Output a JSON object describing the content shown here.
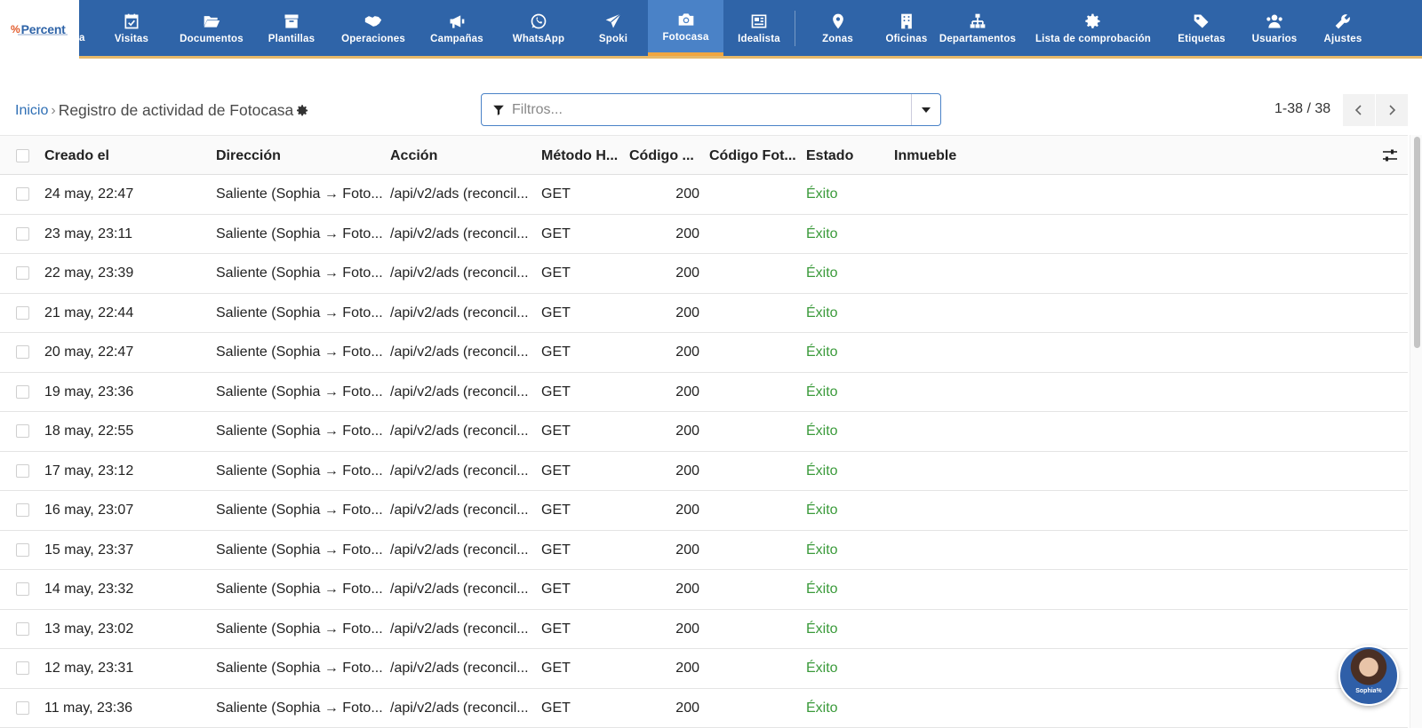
{
  "brand": {
    "logo_mark": "%",
    "logo_word": "Percent"
  },
  "nav": {
    "cut_label": "a",
    "items": [
      {
        "label": "Visitas",
        "icon": "calendar-check-icon"
      },
      {
        "label": "Documentos",
        "icon": "folder-open-icon"
      },
      {
        "label": "Plantillas",
        "icon": "archive-box-icon"
      },
      {
        "label": "Operaciones",
        "icon": "handshake-icon"
      },
      {
        "label": "Campañas",
        "icon": "megaphone-icon"
      },
      {
        "label": "WhatsApp",
        "icon": "whatsapp-icon"
      },
      {
        "label": "Spoki",
        "icon": "paper-plane-icon"
      },
      {
        "label": "Fotocasa",
        "icon": "camera-icon",
        "active": true
      },
      {
        "label": "Idealista",
        "icon": "newspaper-icon"
      },
      {
        "label": "Zonas",
        "icon": "map-pin-icon"
      },
      {
        "label": "Oficinas",
        "icon": "building-icon"
      },
      {
        "label": "Departamentos",
        "icon": "org-chart-icon"
      },
      {
        "label": "Lista de comprobación",
        "icon": "gear-icon"
      },
      {
        "label": "Etiquetas",
        "icon": "tags-icon"
      },
      {
        "label": "Usuarios",
        "icon": "users-icon"
      },
      {
        "label": "Ajustes",
        "icon": "wrench-icon"
      }
    ]
  },
  "breadcrumb": {
    "home": "Inicio",
    "separator": "›",
    "current": "Registro de actividad de Fotocasa"
  },
  "filter": {
    "placeholder": "Filtros..."
  },
  "pagination": {
    "range": "1-38 / 38"
  },
  "table": {
    "columns": {
      "created": "Creado el",
      "direction": "Dirección",
      "action": "Acción",
      "method": "Método H...",
      "code": "Código ...",
      "code_fotocasa": "Código Fot...",
      "status": "Estado",
      "property": "Inmueble"
    },
    "rows": [
      {
        "created": "24 may, 22:47",
        "direction": "Saliente (Sophia → Foto...",
        "action": "/api/v2/ads (reconcil...",
        "method": "GET",
        "code": "200",
        "status": "Éxito"
      },
      {
        "created": "23 may, 23:11",
        "direction": "Saliente (Sophia → Foto...",
        "action": "/api/v2/ads (reconcil...",
        "method": "GET",
        "code": "200",
        "status": "Éxito"
      },
      {
        "created": "22 may, 23:39",
        "direction": "Saliente (Sophia → Foto...",
        "action": "/api/v2/ads (reconcil...",
        "method": "GET",
        "code": "200",
        "status": "Éxito"
      },
      {
        "created": "21 may, 22:44",
        "direction": "Saliente (Sophia → Foto...",
        "action": "/api/v2/ads (reconcil...",
        "method": "GET",
        "code": "200",
        "status": "Éxito"
      },
      {
        "created": "20 may, 22:47",
        "direction": "Saliente (Sophia → Foto...",
        "action": "/api/v2/ads (reconcil...",
        "method": "GET",
        "code": "200",
        "status": "Éxito"
      },
      {
        "created": "19 may, 23:36",
        "direction": "Saliente (Sophia → Foto...",
        "action": "/api/v2/ads (reconcil...",
        "method": "GET",
        "code": "200",
        "status": "Éxito"
      },
      {
        "created": "18 may, 22:55",
        "direction": "Saliente (Sophia → Foto...",
        "action": "/api/v2/ads (reconcil...",
        "method": "GET",
        "code": "200",
        "status": "Éxito"
      },
      {
        "created": "17 may, 23:12",
        "direction": "Saliente (Sophia → Foto...",
        "action": "/api/v2/ads (reconcil...",
        "method": "GET",
        "code": "200",
        "status": "Éxito"
      },
      {
        "created": "16 may, 23:07",
        "direction": "Saliente (Sophia → Foto...",
        "action": "/api/v2/ads (reconcil...",
        "method": "GET",
        "code": "200",
        "status": "Éxito"
      },
      {
        "created": "15 may, 23:37",
        "direction": "Saliente (Sophia → Foto...",
        "action": "/api/v2/ads (reconcil...",
        "method": "GET",
        "code": "200",
        "status": "Éxito"
      },
      {
        "created": "14 may, 23:32",
        "direction": "Saliente (Sophia → Foto...",
        "action": "/api/v2/ads (reconcil...",
        "method": "GET",
        "code": "200",
        "status": "Éxito"
      },
      {
        "created": "13 may, 23:02",
        "direction": "Saliente (Sophia → Foto...",
        "action": "/api/v2/ads (reconcil...",
        "method": "GET",
        "code": "200",
        "status": "Éxito"
      },
      {
        "created": "12 may, 23:31",
        "direction": "Saliente (Sophia → Foto...",
        "action": "/api/v2/ads (reconcil...",
        "method": "GET",
        "code": "200",
        "status": "Éxito"
      },
      {
        "created": "11 may, 23:36",
        "direction": "Saliente (Sophia → Foto...",
        "action": "/api/v2/ads (reconcil...",
        "method": "GET",
        "code": "200",
        "status": "Éxito"
      }
    ]
  },
  "assistant": {
    "label": "Sophia%"
  },
  "colors": {
    "nav_bg": "#2f64a8",
    "nav_active": "#4a82c7",
    "nav_underline": "#e6b96a",
    "success": "#3a9a3a",
    "link": "#2f6fb5"
  }
}
